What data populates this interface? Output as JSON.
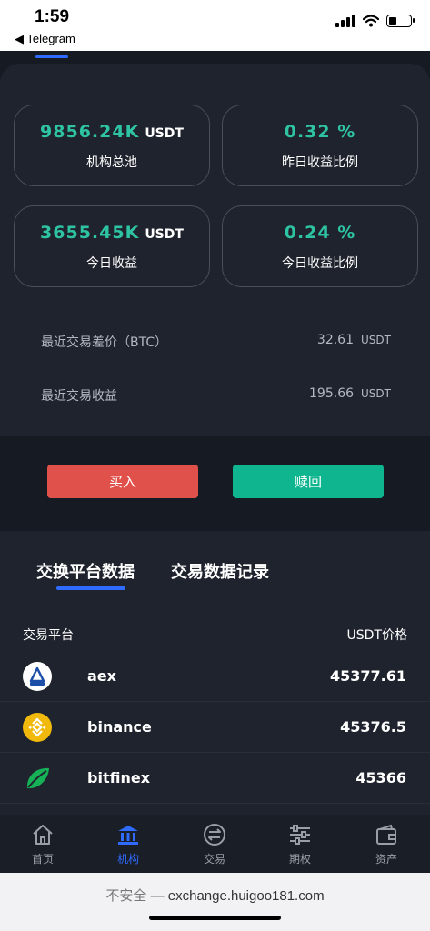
{
  "status_bar": {
    "time": "1:59",
    "back_app": "◀ Telegram"
  },
  "stats": [
    {
      "value": "9856.24K",
      "unit": "USDT",
      "label": "机构总池"
    },
    {
      "value": "0.32 %",
      "unit": "",
      "label": "昨日收益比例"
    },
    {
      "value": "3655.45K",
      "unit": "USDT",
      "label": "今日收益"
    },
    {
      "value": "0.24 %",
      "unit": "",
      "label": "今日收益比例"
    }
  ],
  "info_rows": [
    {
      "label": "最近交易差价（BTC）",
      "value": "32.61",
      "unit": "USDT"
    },
    {
      "label": "最近交易收益",
      "value": "195.66",
      "unit": "USDT"
    }
  ],
  "actions": {
    "buy": "买入",
    "redeem": "赎回"
  },
  "tabs": [
    {
      "label": "交换平台数据",
      "active": true
    },
    {
      "label": "交易数据记录",
      "active": false
    }
  ],
  "table": {
    "col_platform": "交易平台",
    "col_price": "USDT价格",
    "rows": [
      {
        "name": "aex",
        "price": "45377.61",
        "icon": "aex-logo-icon",
        "color": "#ffffff"
      },
      {
        "name": "binance",
        "price": "45376.5",
        "icon": "binance-logo-icon",
        "color": "#f0b90b"
      },
      {
        "name": "bitfinex",
        "price": "45366",
        "icon": "bitfinex-logo-icon",
        "color": "#16b157"
      }
    ]
  },
  "nav": [
    {
      "label": "首页",
      "icon": "home-icon",
      "active": false
    },
    {
      "label": "机构",
      "icon": "institution-icon",
      "active": true
    },
    {
      "label": "交易",
      "icon": "exchange-icon",
      "active": false
    },
    {
      "label": "期权",
      "icon": "sliders-icon",
      "active": false
    },
    {
      "label": "资产",
      "icon": "wallet-icon",
      "active": false
    }
  ],
  "browser": {
    "insecure": "不安全 —",
    "url": "exchange.huigoo181.com"
  },
  "colors": {
    "accent": "#2f6bff",
    "green": "#2ec4a3",
    "buy": "#e0514c",
    "redeem": "#0fb58f"
  }
}
